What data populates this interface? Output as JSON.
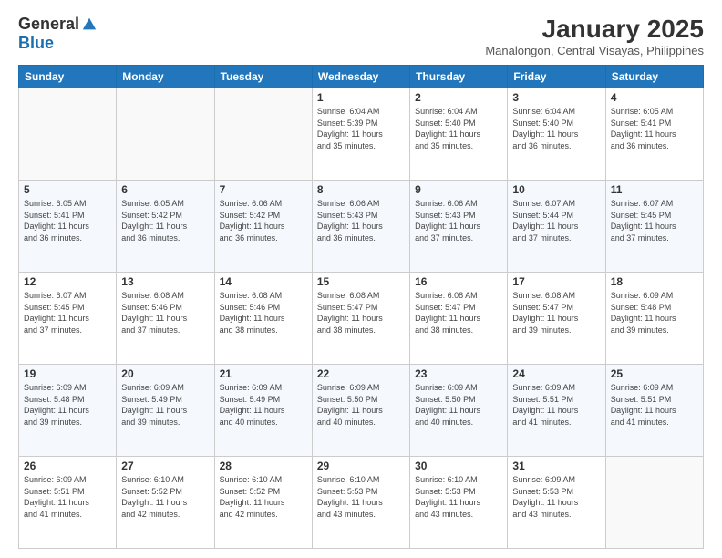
{
  "logo": {
    "general": "General",
    "blue": "Blue"
  },
  "title": "January 2025",
  "subtitle": "Manalongon, Central Visayas, Philippines",
  "weekdays": [
    "Sunday",
    "Monday",
    "Tuesday",
    "Wednesday",
    "Thursday",
    "Friday",
    "Saturday"
  ],
  "weeks": [
    [
      {
        "day": "",
        "info": ""
      },
      {
        "day": "",
        "info": ""
      },
      {
        "day": "",
        "info": ""
      },
      {
        "day": "1",
        "info": "Sunrise: 6:04 AM\nSunset: 5:39 PM\nDaylight: 11 hours\nand 35 minutes."
      },
      {
        "day": "2",
        "info": "Sunrise: 6:04 AM\nSunset: 5:40 PM\nDaylight: 11 hours\nand 35 minutes."
      },
      {
        "day": "3",
        "info": "Sunrise: 6:04 AM\nSunset: 5:40 PM\nDaylight: 11 hours\nand 36 minutes."
      },
      {
        "day": "4",
        "info": "Sunrise: 6:05 AM\nSunset: 5:41 PM\nDaylight: 11 hours\nand 36 minutes."
      }
    ],
    [
      {
        "day": "5",
        "info": "Sunrise: 6:05 AM\nSunset: 5:41 PM\nDaylight: 11 hours\nand 36 minutes."
      },
      {
        "day": "6",
        "info": "Sunrise: 6:05 AM\nSunset: 5:42 PM\nDaylight: 11 hours\nand 36 minutes."
      },
      {
        "day": "7",
        "info": "Sunrise: 6:06 AM\nSunset: 5:42 PM\nDaylight: 11 hours\nand 36 minutes."
      },
      {
        "day": "8",
        "info": "Sunrise: 6:06 AM\nSunset: 5:43 PM\nDaylight: 11 hours\nand 36 minutes."
      },
      {
        "day": "9",
        "info": "Sunrise: 6:06 AM\nSunset: 5:43 PM\nDaylight: 11 hours\nand 37 minutes."
      },
      {
        "day": "10",
        "info": "Sunrise: 6:07 AM\nSunset: 5:44 PM\nDaylight: 11 hours\nand 37 minutes."
      },
      {
        "day": "11",
        "info": "Sunrise: 6:07 AM\nSunset: 5:45 PM\nDaylight: 11 hours\nand 37 minutes."
      }
    ],
    [
      {
        "day": "12",
        "info": "Sunrise: 6:07 AM\nSunset: 5:45 PM\nDaylight: 11 hours\nand 37 minutes."
      },
      {
        "day": "13",
        "info": "Sunrise: 6:08 AM\nSunset: 5:46 PM\nDaylight: 11 hours\nand 37 minutes."
      },
      {
        "day": "14",
        "info": "Sunrise: 6:08 AM\nSunset: 5:46 PM\nDaylight: 11 hours\nand 38 minutes."
      },
      {
        "day": "15",
        "info": "Sunrise: 6:08 AM\nSunset: 5:47 PM\nDaylight: 11 hours\nand 38 minutes."
      },
      {
        "day": "16",
        "info": "Sunrise: 6:08 AM\nSunset: 5:47 PM\nDaylight: 11 hours\nand 38 minutes."
      },
      {
        "day": "17",
        "info": "Sunrise: 6:08 AM\nSunset: 5:47 PM\nDaylight: 11 hours\nand 39 minutes."
      },
      {
        "day": "18",
        "info": "Sunrise: 6:09 AM\nSunset: 5:48 PM\nDaylight: 11 hours\nand 39 minutes."
      }
    ],
    [
      {
        "day": "19",
        "info": "Sunrise: 6:09 AM\nSunset: 5:48 PM\nDaylight: 11 hours\nand 39 minutes."
      },
      {
        "day": "20",
        "info": "Sunrise: 6:09 AM\nSunset: 5:49 PM\nDaylight: 11 hours\nand 39 minutes."
      },
      {
        "day": "21",
        "info": "Sunrise: 6:09 AM\nSunset: 5:49 PM\nDaylight: 11 hours\nand 40 minutes."
      },
      {
        "day": "22",
        "info": "Sunrise: 6:09 AM\nSunset: 5:50 PM\nDaylight: 11 hours\nand 40 minutes."
      },
      {
        "day": "23",
        "info": "Sunrise: 6:09 AM\nSunset: 5:50 PM\nDaylight: 11 hours\nand 40 minutes."
      },
      {
        "day": "24",
        "info": "Sunrise: 6:09 AM\nSunset: 5:51 PM\nDaylight: 11 hours\nand 41 minutes."
      },
      {
        "day": "25",
        "info": "Sunrise: 6:09 AM\nSunset: 5:51 PM\nDaylight: 11 hours\nand 41 minutes."
      }
    ],
    [
      {
        "day": "26",
        "info": "Sunrise: 6:09 AM\nSunset: 5:51 PM\nDaylight: 11 hours\nand 41 minutes."
      },
      {
        "day": "27",
        "info": "Sunrise: 6:10 AM\nSunset: 5:52 PM\nDaylight: 11 hours\nand 42 minutes."
      },
      {
        "day": "28",
        "info": "Sunrise: 6:10 AM\nSunset: 5:52 PM\nDaylight: 11 hours\nand 42 minutes."
      },
      {
        "day": "29",
        "info": "Sunrise: 6:10 AM\nSunset: 5:53 PM\nDaylight: 11 hours\nand 43 minutes."
      },
      {
        "day": "30",
        "info": "Sunrise: 6:10 AM\nSunset: 5:53 PM\nDaylight: 11 hours\nand 43 minutes."
      },
      {
        "day": "31",
        "info": "Sunrise: 6:09 AM\nSunset: 5:53 PM\nDaylight: 11 hours\nand 43 minutes."
      },
      {
        "day": "",
        "info": ""
      }
    ]
  ]
}
